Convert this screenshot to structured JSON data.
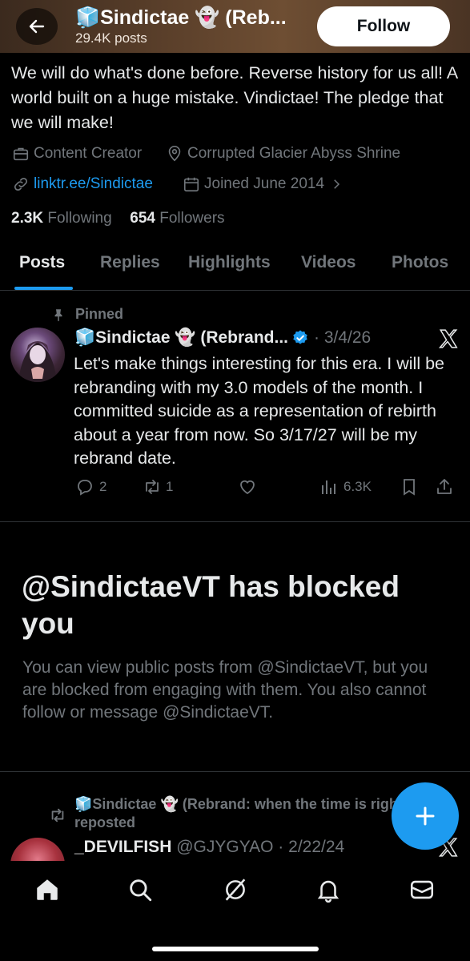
{
  "header": {
    "display_name": "🧊Sindictae 👻 (Reb...",
    "post_count": "29.4K posts",
    "follow_label": "Follow"
  },
  "bio": {
    "text": "We will do what's done before. Reverse history for us all! A world built on a huge mistake. Vindictae! The pledge that we will make!",
    "category": "Content Creator",
    "location": "Corrupted Glacier Abyss Shrine",
    "link": "linktr.ee/Sindictae",
    "joined": "Joined June 2014"
  },
  "stats": {
    "following_count": "2.3K",
    "following_label": "Following",
    "followers_count": "654",
    "followers_label": "Followers"
  },
  "tabs": [
    {
      "label": "Posts"
    },
    {
      "label": "Replies"
    },
    {
      "label": "Highlights"
    },
    {
      "label": "Videos"
    },
    {
      "label": "Photos"
    }
  ],
  "pinned_post": {
    "pinned_label": "Pinned",
    "author": "🧊Sindictae 👻 (Rebrand...",
    "date": "· 3/4/26",
    "text": "Let's make things interesting for this era. I will be rebranding with my 3.0 models of the month. I committed suicide as a representation of rebirth about a year from now. So 3/17/27 will be my rebrand date.",
    "replies": "2",
    "reposts": "1",
    "views": "6.3K"
  },
  "blocked": {
    "title": "@SindictaeVT has blocked you",
    "description": "You can view public posts from @SindictaeVT, but you are blocked from engaging with them. You also cannot follow or message @SindictaeVT."
  },
  "repost": {
    "label": "🧊Sindictae 👻 (Rebrand: when the time is right) reposted",
    "author": "_DEVILFISH",
    "handle": " @GJYGYAO · 2/22/24"
  },
  "colors": {
    "accent": "#1d9bf0",
    "muted": "#71767b",
    "text": "#e7e9ea",
    "verified": "#1d9bf0"
  },
  "icons": [
    "back-arrow-icon",
    "briefcase-icon",
    "location-pin-icon",
    "link-icon",
    "calendar-icon",
    "pin-icon",
    "verified-badge-icon",
    "x-logo-icon",
    "reply-icon",
    "repost-icon",
    "like-icon",
    "views-icon",
    "bookmark-icon",
    "share-icon",
    "plus-icon",
    "home-icon",
    "search-icon",
    "grok-icon",
    "bell-icon",
    "mail-icon"
  ]
}
